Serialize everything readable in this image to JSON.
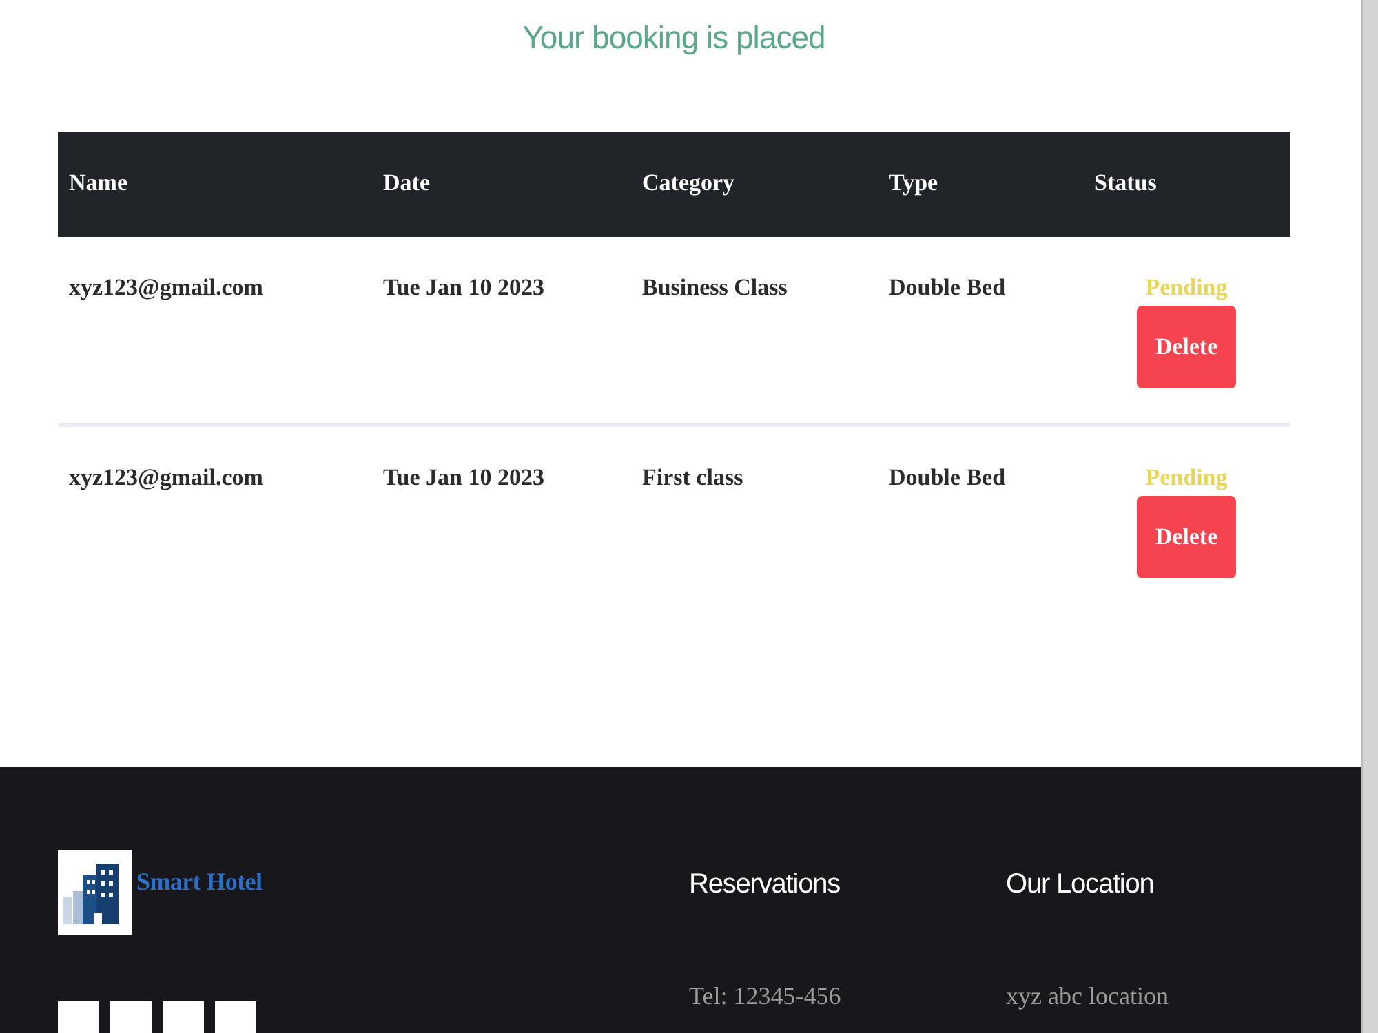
{
  "heading": "Your booking is placed",
  "table": {
    "columns": [
      "Name",
      "Date",
      "Category",
      "Type",
      "Status"
    ],
    "rows": [
      {
        "name": "xyz123@gmail.com",
        "date": "Tue Jan 10 2023",
        "category": "Business Class",
        "type": "Double Bed",
        "status": "Pending",
        "action": "Delete"
      },
      {
        "name": "xyz123@gmail.com",
        "date": "Tue Jan 10 2023",
        "category": "First class",
        "type": "Double Bed",
        "status": "Pending",
        "action": "Delete"
      }
    ]
  },
  "footer": {
    "brand": "Smart Hotel",
    "columns": [
      {
        "heading": "Reservations",
        "lines": [
          "Tel: 12345-456"
        ]
      },
      {
        "heading": "Our Location",
        "lines": [
          "xyz abc location"
        ]
      }
    ]
  }
}
